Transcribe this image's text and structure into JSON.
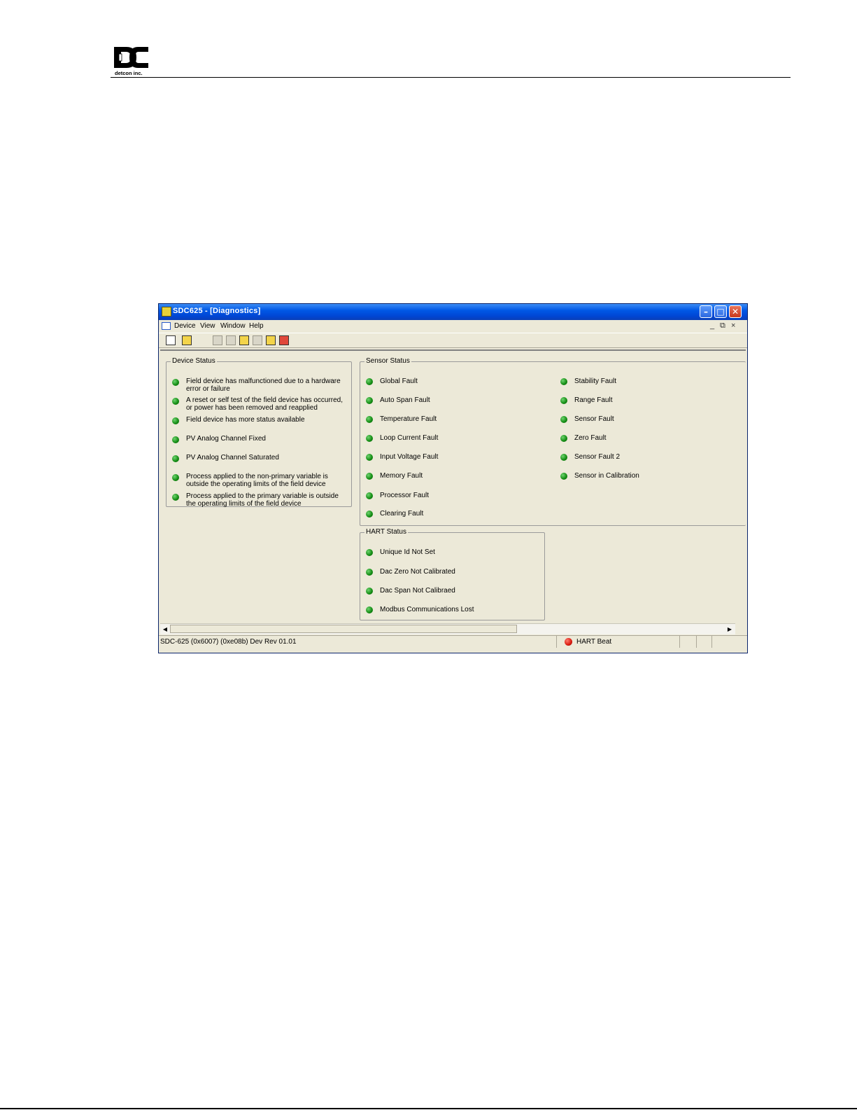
{
  "header": {
    "logo_name": "detcon-logo",
    "logo_text": "detcon inc."
  },
  "window": {
    "title": "SDC625 - [Diagnostics]",
    "menu": [
      "Device",
      "View",
      "Window",
      "Help"
    ],
    "mdi_controls": [
      "_",
      "⧉",
      "×"
    ],
    "title_controls": [
      "minimize",
      "maximize",
      "close"
    ]
  },
  "device_status": {
    "title": "Device Status",
    "items": [
      "Field device has malfunctioned due to a hardware error or failure",
      "A reset or self test of the field device has occurred, or power has been removed and reapplied",
      "Field device has more status available",
      "PV Analog Channel Fixed",
      "PV Analog Channel Saturated",
      "Process applied to the non-primary variable is outside the operating limits of the field device",
      "Process applied to the primary variable is outside the operating limits of the field device"
    ]
  },
  "sensor_status": {
    "title": "Sensor Status",
    "col1": [
      "Global Fault",
      "Auto Span Fault",
      "Temperature Fault",
      "Loop Current Fault",
      "Input Voltage Fault",
      "Memory Fault",
      "Processor Fault",
      "Clearing Fault"
    ],
    "col2": [
      "Stability Fault",
      "Range Fault",
      "Sensor Fault",
      "Zero Fault",
      "Sensor Fault 2",
      "Sensor in Calibration"
    ]
  },
  "hart_status": {
    "title": "HART Status",
    "items": [
      "Unique Id Not Set",
      "Dac Zero Not Calibrated",
      "Dac Span Not Calibraed",
      "Modbus Communications Lost"
    ]
  },
  "statusbar": {
    "device_info": "SDC-625   (0x6007)  (0xe08b) Dev Rev 01.01",
    "hart_beat": "HART Beat"
  },
  "colors": {
    "ok_led": "#118a11",
    "hart_led": "#d81a0e",
    "titlebar": "#0058e6",
    "face": "#ece9d8"
  }
}
